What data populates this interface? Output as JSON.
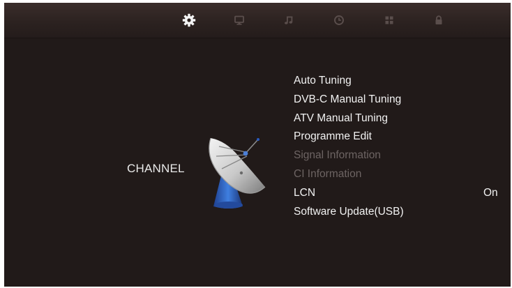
{
  "tabs": [
    {
      "icon": "gear-icon",
      "active": true
    },
    {
      "icon": "monitor-icon",
      "active": false
    },
    {
      "icon": "music-note-icon",
      "active": false
    },
    {
      "icon": "clock-icon",
      "active": false
    },
    {
      "icon": "grid-icon",
      "active": false
    },
    {
      "icon": "lock-icon",
      "active": false
    }
  ],
  "section": {
    "label": "CHANNEL",
    "icon": "satellite-dish-icon"
  },
  "menu": {
    "items": [
      {
        "label": "Auto Tuning",
        "enabled": true
      },
      {
        "label": "DVB-C Manual Tuning",
        "enabled": true
      },
      {
        "label": "ATV Manual Tuning",
        "enabled": true
      },
      {
        "label": "Programme Edit",
        "enabled": true
      },
      {
        "label": "Signal Information",
        "enabled": false
      },
      {
        "label": "CI Information",
        "enabled": false
      },
      {
        "label": "LCN",
        "enabled": true,
        "value": "On"
      },
      {
        "label": "Software Update(USB)",
        "enabled": true
      }
    ]
  },
  "colors": {
    "background": "#211a19",
    "topbar": "#2c2220",
    "active_icon": "#f4f4f4",
    "inactive_icon": "#5a4e4c",
    "text": "#f2f2f2",
    "disabled_text": "#6d6463"
  }
}
